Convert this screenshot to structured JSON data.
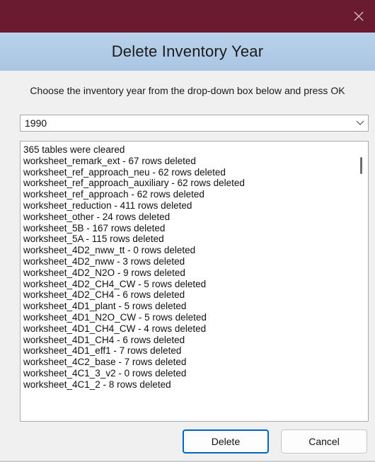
{
  "window": {
    "title": "Delete Inventory Year",
    "colors": {
      "titlebar": "#6b1b30",
      "accent": "#0067c0"
    }
  },
  "instruction": "Choose the inventory year from the drop-down box below and press OK",
  "year_select": {
    "value": "1990",
    "icon": "chevron-down-icon"
  },
  "log_lines": [
    "365 tables were cleared",
    "worksheet_remark_ext - 67 rows deleted",
    "worksheet_ref_approach_neu - 62 rows deleted",
    "worksheet_ref_approach_auxiliary - 62 rows deleted",
    "worksheet_ref_approach - 62 rows deleted",
    "worksheet_reduction - 411 rows deleted",
    "worksheet_other - 24 rows deleted",
    "worksheet_5B - 167 rows deleted",
    "worksheet_5A - 115 rows deleted",
    "worksheet_4D2_nww_tt - 0 rows deleted",
    "worksheet_4D2_nww - 3 rows deleted",
    "worksheet_4D2_N2O - 9 rows deleted",
    "worksheet_4D2_CH4_CW - 5 rows deleted",
    "worksheet_4D2_CH4 - 6 rows deleted",
    "worksheet_4D1_plant - 5 rows deleted",
    "worksheet_4D1_N2O_CW - 5 rows deleted",
    "worksheet_4D1_CH4_CW - 4 rows deleted",
    "worksheet_4D1_CH4 - 6 rows deleted",
    "worksheet_4D1_eff1 - 7 rows deleted",
    "worksheet_4C2_base - 7 rows deleted",
    "worksheet_4C1_3_v2 - 0 rows deleted",
    "worksheet_4C1_2 - 8 rows deleted"
  ],
  "buttons": {
    "delete": "Delete",
    "cancel": "Cancel"
  }
}
